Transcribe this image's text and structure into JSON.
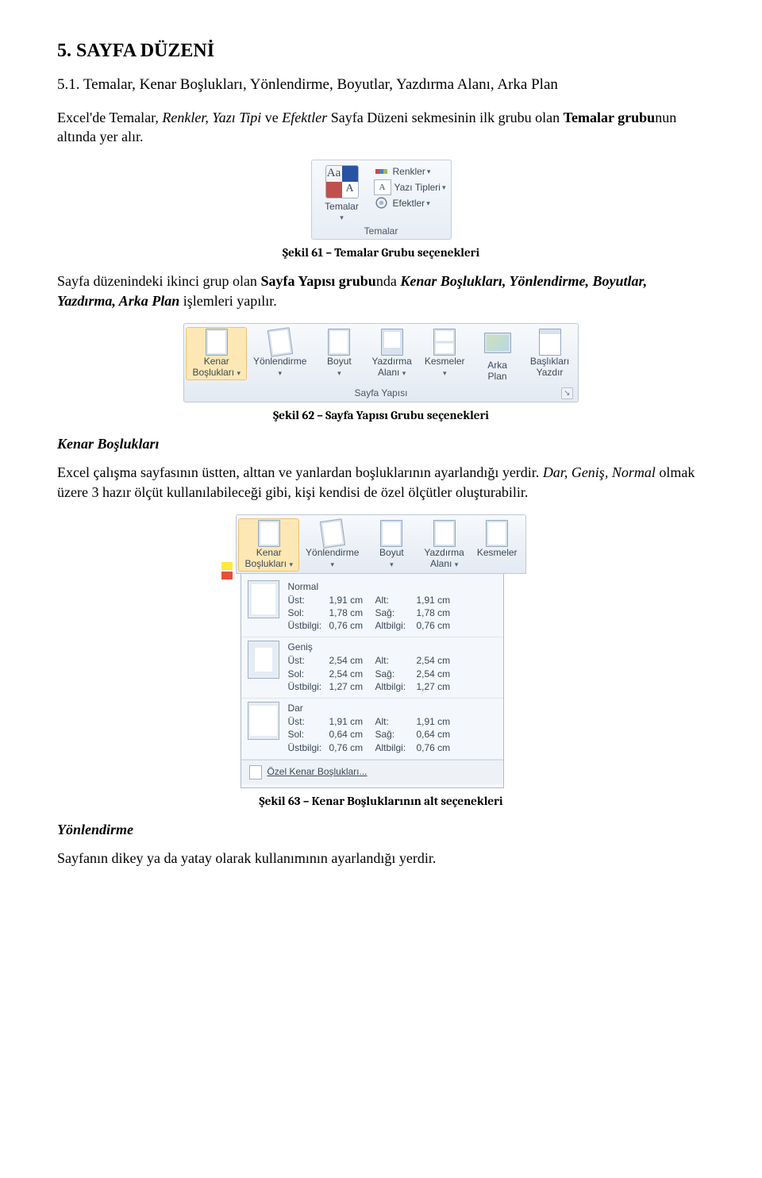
{
  "section": {
    "num_title": "5. SAYFA DÜZENİ"
  },
  "subsection": {
    "title": "5.1. Temalar, Kenar Boşlukları, Yönlendirme, Boyutlar, Yazdırma Alanı, Arka Plan"
  },
  "para1_a": "Excel'de Temalar, ",
  "para1_b": "Renkler, Yazı Tipi",
  "para1_c": " ve ",
  "para1_d": "Efektler",
  "para1_e": " Sayfa Düzeni sekmesinin ilk grubu olan ",
  "para1_f": "Temalar grubu",
  "para1_g": "nun altında yer alır.",
  "fig61": {
    "caption": "Şekil 61 – Temalar Grubu seçenekleri",
    "themes_label": "Temalar",
    "aa_top": "Aa",
    "aa_bot": "A",
    "rows": {
      "colors": "Renkler",
      "fonts": "Yazı Tipleri",
      "effects": "Efektler"
    },
    "footer": "Temalar"
  },
  "para2_a": "Sayfa düzenindeki ikinci grup olan ",
  "para2_b": "Sayfa Yapısı grubu",
  "para2_c": "nda ",
  "para2_d": "Kenar Boşlukları, Yönlendirme, Boyutlar, Yazdırma, Arka Plan",
  "para2_e": " işlemleri yapılır.",
  "fig62": {
    "caption": "Şekil 62 – Sayfa Yapısı Grubu seçenekleri",
    "items": {
      "margins": {
        "l1": "Kenar",
        "l2": "Boşlukları"
      },
      "orient": "Yönlendirme",
      "size": "Boyut",
      "printarea": {
        "l1": "Yazdırma",
        "l2": "Alanı"
      },
      "breaks": "Kesmeler",
      "bg": {
        "l1": "Arka",
        "l2": "Plan"
      },
      "titles": {
        "l1": "Başlıkları",
        "l2": "Yazdır"
      }
    },
    "footer": "Sayfa Yapısı"
  },
  "subhead_margins": "Kenar Boşlukları",
  "para3_a": "Excel çalışma sayfasının üstten, alttan ve yanlardan boşluklarının ayarlandığı yerdir. ",
  "para3_b": "Dar, Geniş, Normal",
  "para3_c": " olmak üzere 3 hazır ölçüt kullanılabileceği gibi, kişi kendisi de özel ölçütler oluşturabilir.",
  "fig63": {
    "caption": "Şekil 63 – Kenar Boşluklarının alt seçenekleri",
    "opts": [
      {
        "name": "Normal",
        "ust_l": "Üst:",
        "ust_v": "1,91 cm",
        "alt_l": "Alt:",
        "alt_v": "1,91 cm",
        "sol_l": "Sol:",
        "sol_v": "1,78 cm",
        "sag_l": "Sağ:",
        "sag_v": "1,78 cm",
        "ub_l": "Üstbilgi:",
        "ub_v": "0,76 cm",
        "ab_l": "Altbilgi:",
        "ab_v": "0,76 cm",
        "thumb": "normal"
      },
      {
        "name": "Geniş",
        "ust_l": "Üst:",
        "ust_v": "2,54 cm",
        "alt_l": "Alt:",
        "alt_v": "2,54 cm",
        "sol_l": "Sol:",
        "sol_v": "2,54 cm",
        "sag_l": "Sağ:",
        "sag_v": "2,54 cm",
        "ub_l": "Üstbilgi:",
        "ub_v": "1,27 cm",
        "ab_l": "Altbilgi:",
        "ab_v": "1,27 cm",
        "thumb": "wide"
      },
      {
        "name": "Dar",
        "ust_l": "Üst:",
        "ust_v": "1,91 cm",
        "alt_l": "Alt:",
        "alt_v": "1,91 cm",
        "sol_l": "Sol:",
        "sol_v": "0,64 cm",
        "sag_l": "Sağ:",
        "sag_v": "0,64 cm",
        "ub_l": "Üstbilgi:",
        "ub_v": "0,76 cm",
        "ab_l": "Altbilgi:",
        "ab_v": "0,76 cm",
        "thumb": "narrow"
      }
    ],
    "custom": "Özel Kenar Boşlukları..."
  },
  "subhead_orient": "Yönlendirme",
  "para4": "Sayfanın dikey ya da yatay olarak kullanımının ayarlandığı yerdir."
}
